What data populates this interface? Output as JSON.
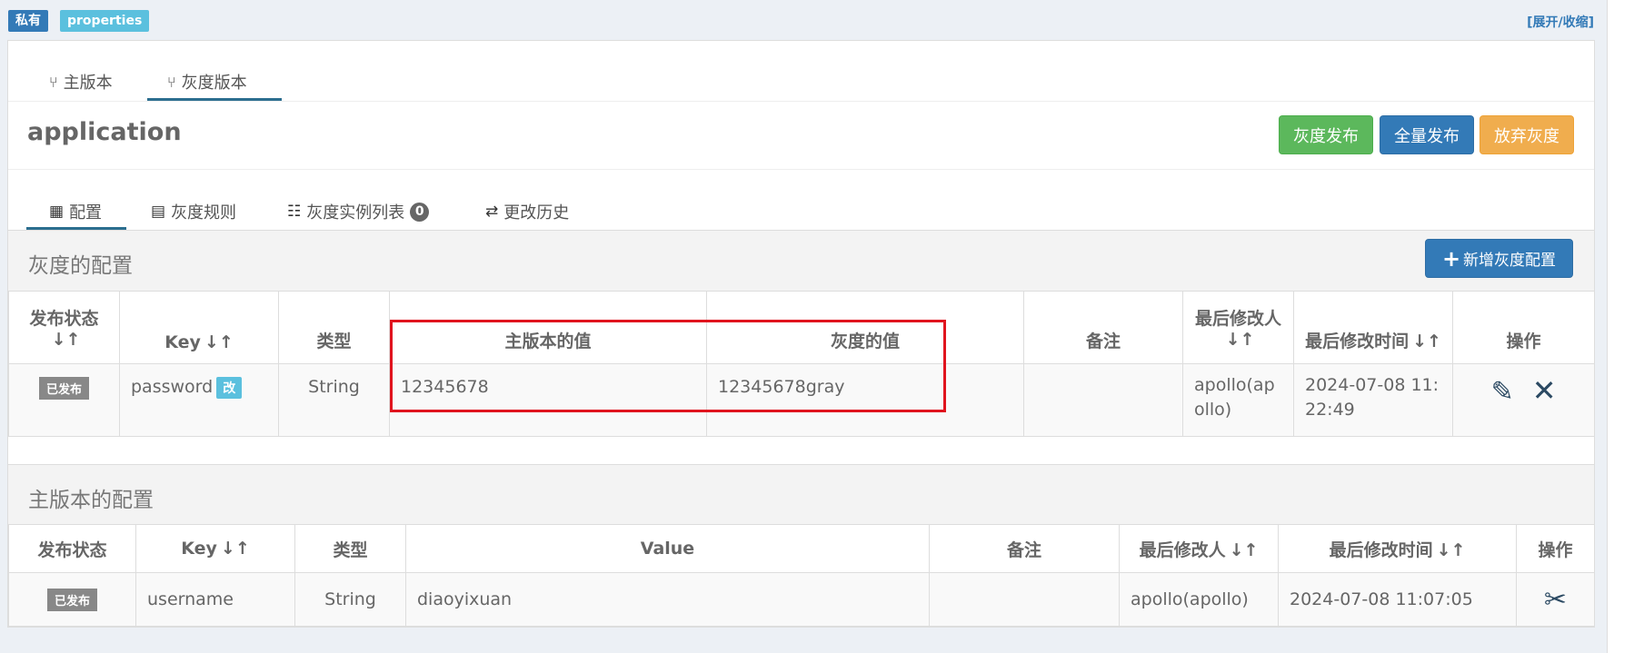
{
  "header": {
    "scope_badge": "私有",
    "format_badge": "properties",
    "expand_link": "[展开/收缩]"
  },
  "version_tabs": [
    {
      "label": "主版本",
      "active": false
    },
    {
      "label": "灰度版本",
      "active": true
    }
  ],
  "app_name": "application",
  "actions": {
    "gray_publish": "灰度发布",
    "full_publish": "全量发布",
    "abandon_gray": "放弃灰度"
  },
  "sub_tabs": [
    {
      "label": "配置",
      "icon": "table-icon",
      "active": true
    },
    {
      "label": "灰度规则",
      "icon": "document-icon",
      "active": false
    },
    {
      "label": "灰度实例列表",
      "icon": "list-icon",
      "badge": "0",
      "active": false
    },
    {
      "label": "更改历史",
      "icon": "transfer-icon",
      "active": false
    }
  ],
  "gray_section": {
    "title": "灰度的配置",
    "add_button": "新增灰度配置",
    "columns": [
      "发布状态",
      "Key",
      "类型",
      "主版本的值",
      "灰度的值",
      "备注",
      "最后修改人",
      "最后修改时间",
      "操作"
    ],
    "rows": [
      {
        "status": "已发布",
        "key": "password",
        "modified_tag": "改",
        "type": "String",
        "master_value": "12345678",
        "gray_value": "12345678gray",
        "comment": "",
        "modifier": "apollo(apollo)",
        "modified_time": "2024-07-08 11:22:49"
      }
    ]
  },
  "master_section": {
    "title": "主版本的配置",
    "columns": [
      "发布状态",
      "Key",
      "类型",
      "Value",
      "备注",
      "最后修改人",
      "最后修改时间",
      "操作"
    ],
    "rows": [
      {
        "status": "已发布",
        "key": "username",
        "type": "String",
        "value": "diaoyixuan",
        "comment": "",
        "modifier": "apollo(apollo)",
        "modified_time": "2024-07-08 11:07:05"
      }
    ]
  },
  "colors": {
    "primary": "#337ab7",
    "success": "#5cb85c",
    "warning": "#f0ad4e",
    "info": "#5bc0de",
    "highlight_box": "#e0141e"
  }
}
